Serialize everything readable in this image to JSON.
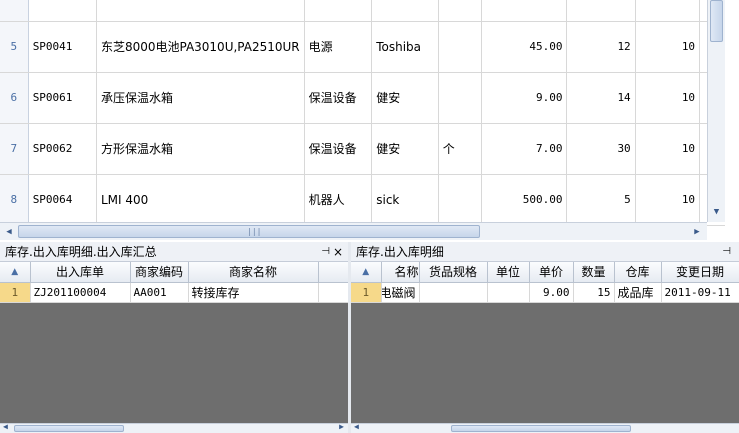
{
  "top_grid": {
    "rows": [
      {
        "num": "",
        "code": "",
        "name": "",
        "category": "",
        "brand": "",
        "unit": "",
        "price": "",
        "qty": "",
        "min": ""
      },
      {
        "num": "5",
        "code": "SP0041",
        "name": "东芝8000电池PA3010U,PA2510UR",
        "category": "电源",
        "brand": "Toshiba",
        "unit": "",
        "price": "45.00",
        "qty": "12",
        "min": "10"
      },
      {
        "num": "6",
        "code": "SP0061",
        "name": "承压保温水箱",
        "category": "保温设备",
        "brand": "健安",
        "unit": "",
        "price": "9.00",
        "qty": "14",
        "min": "10"
      },
      {
        "num": "7",
        "code": "SP0062",
        "name": "方形保温水箱",
        "category": "保温设备",
        "brand": "健安",
        "unit": "个",
        "price": "7.00",
        "qty": "30",
        "min": "10"
      },
      {
        "num": "8",
        "code": "SP0064",
        "name": "LMI 400",
        "category": "机器人",
        "brand": "sick",
        "unit": "",
        "price": "500.00",
        "qty": "5",
        "min": "10"
      }
    ]
  },
  "left_panel": {
    "title": "库存.出入库明细.出入库汇总",
    "pin_icon": "⊣",
    "close_icon": "×",
    "corner_icon": "▲",
    "columns": [
      "出入库单",
      "商家编码",
      "商家名称"
    ],
    "rows": [
      {
        "num": "1",
        "order": "ZJ201100004",
        "merchant_code": "AA001",
        "merchant_name": "转接库存"
      }
    ]
  },
  "right_panel": {
    "title": "库存.出入库明细",
    "pin_icon": "⊣",
    "corner_icon": "▲",
    "columns": [
      "名称",
      "货品规格",
      "单位",
      "单价",
      "数量",
      "仓库",
      "变更日期"
    ],
    "rows": [
      {
        "num": "1",
        "name": "电磁阀",
        "spec": "",
        "unit": "",
        "price": "9.00",
        "qty": "15",
        "warehouse": "成品库",
        "date": "2011-09-11"
      }
    ]
  }
}
